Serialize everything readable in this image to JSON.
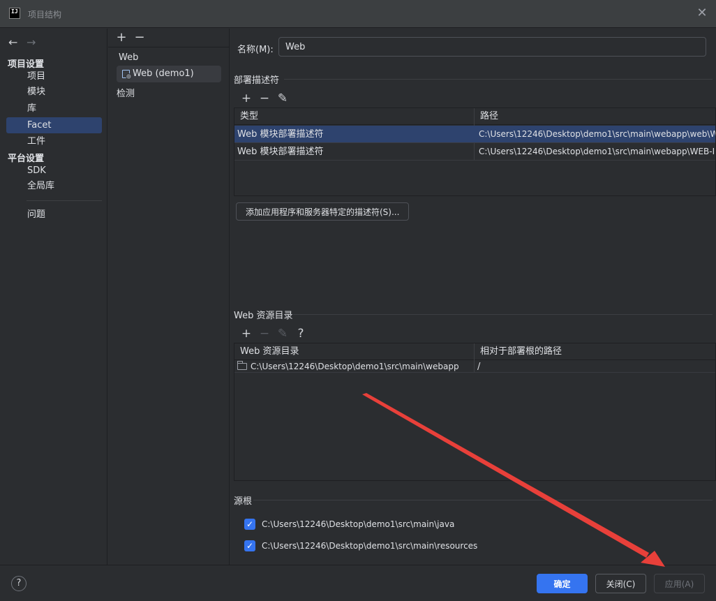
{
  "window": {
    "title": "项目结构",
    "app_icon": "IJ"
  },
  "nav": {
    "back_icon": "←",
    "forward_icon": "→",
    "section_project": "项目设置",
    "items_project": [
      "项目",
      "模块",
      "库",
      "Facet",
      "工件"
    ],
    "section_platform": "平台设置",
    "items_platform": [
      "SDK",
      "全局库"
    ],
    "problems": "问题",
    "selected": "Facet"
  },
  "facets": {
    "add": "+",
    "remove": "−",
    "group": "Web",
    "node": "Web (demo1)",
    "detect": "检测"
  },
  "main": {
    "name_label": "名称(M):",
    "name_value": "Web",
    "descriptors": {
      "title": "部署描述符",
      "col_type": "类型",
      "col_path": "路径",
      "rows": [
        {
          "type": "Web 模块部署描述符",
          "path": "C:\\Users\\12246\\Desktop\\demo1\\src\\main\\webapp\\web\\W"
        },
        {
          "type": "Web 模块部署描述符",
          "path": "C:\\Users\\12246\\Desktop\\demo1\\src\\main\\webapp\\WEB-I"
        }
      ],
      "add_button": "添加应用程序和服务器特定的描述符(S)..."
    },
    "resources": {
      "title": "Web 资源目录",
      "help": "?",
      "col_dir": "Web 资源目录",
      "col_rel": "相对于部署根的路径",
      "rows": [
        {
          "dir": "C:\\Users\\12246\\Desktop\\demo1\\src\\main\\webapp",
          "rel": "/"
        }
      ]
    },
    "sources": {
      "title": "源根",
      "items": [
        "C:\\Users\\12246\\Desktop\\demo1\\src\\main\\java",
        "C:\\Users\\12246\\Desktop\\demo1\\src\\main\\resources"
      ]
    }
  },
  "footer": {
    "help": "?",
    "ok": "确定",
    "close": "关闭(C)",
    "apply": "应用(A)"
  },
  "colors": {
    "accent": "#3574f0",
    "selection": "#2e436e",
    "annotation_arrow": "#e8403a"
  }
}
